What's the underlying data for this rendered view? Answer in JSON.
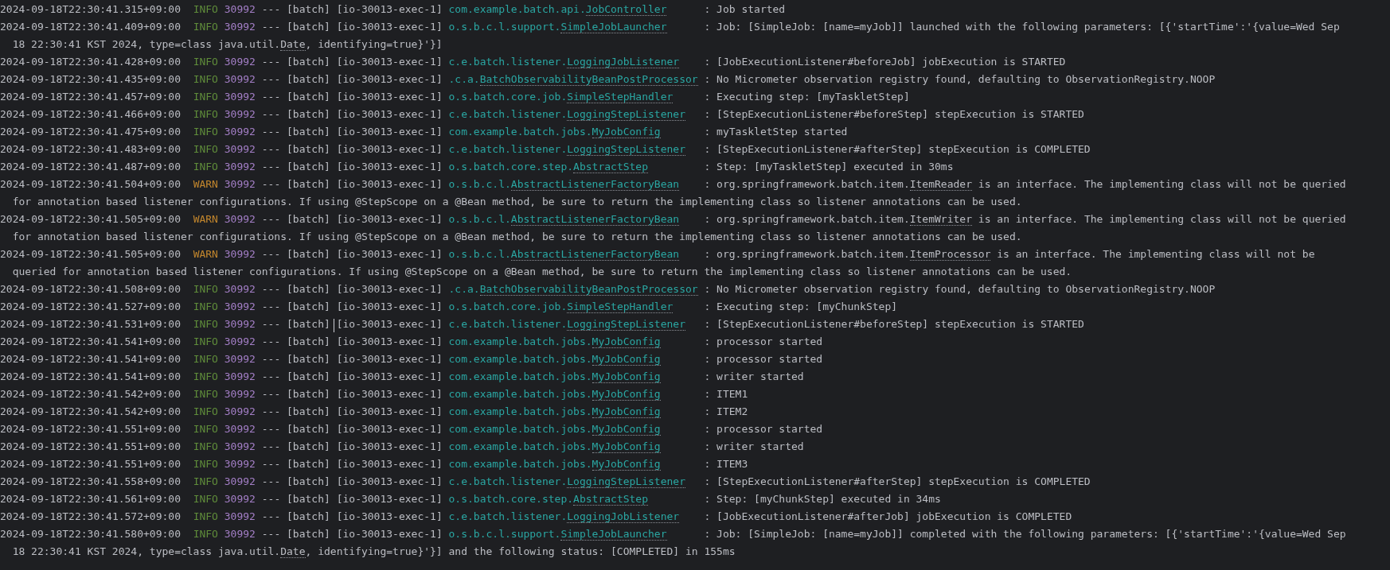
{
  "console": {
    "entries": [
      {
        "timestamp": "2024-09-18T22:30:41.315+09:00",
        "level": "INFO",
        "kind": "info",
        "pid": "30992",
        "separator": "---",
        "app": "[batch]",
        "thread": "[io-30013-exec-1]",
        "logger": {
          "package": "com.example.batch.api.",
          "class": "JobController"
        },
        "lines": [
          {
            "pre": ": Job started"
          }
        ]
      },
      {
        "timestamp": "2024-09-18T22:30:41.409+09:00",
        "level": "INFO",
        "kind": "info",
        "pid": "30992",
        "separator": "---",
        "app": "[batch]",
        "thread": "[io-30013-exec-1]",
        "logger": {
          "package": "o.s.b.c.l.support.",
          "class": "SimpleJobLauncher"
        },
        "lines": [
          {
            "pre": ": Job: [SimpleJob: [name=myJob]] launched with the following parameters: [{'startTime':'{value=Wed Sep"
          },
          {
            "pre": "18 22:30:41 KST 2024, type=class java.util.",
            "link": "Date",
            "post": ", identifying=true}'}]"
          }
        ]
      },
      {
        "timestamp": "2024-09-18T22:30:41.428+09:00",
        "level": "INFO",
        "kind": "info",
        "pid": "30992",
        "separator": "---",
        "app": "[batch]",
        "thread": "[io-30013-exec-1]",
        "logger": {
          "package": "c.e.batch.listener.",
          "class": "LoggingJobListener"
        },
        "lines": [
          {
            "pre": ": [JobExecutionListener#beforeJob] jobExecution is STARTED"
          }
        ]
      },
      {
        "timestamp": "2024-09-18T22:30:41.435+09:00",
        "level": "INFO",
        "kind": "info",
        "pid": "30992",
        "separator": "---",
        "app": "[batch]",
        "thread": "[io-30013-exec-1]",
        "logger": {
          "package": ".c.a.",
          "class": "BatchObservabilityBeanPostProcessor"
        },
        "lines": [
          {
            "pre": ": No Micrometer observation registry found, defaulting to ObservationRegistry.NOOP"
          }
        ]
      },
      {
        "timestamp": "2024-09-18T22:30:41.457+09:00",
        "level": "INFO",
        "kind": "info",
        "pid": "30992",
        "separator": "---",
        "app": "[batch]",
        "thread": "[io-30013-exec-1]",
        "logger": {
          "package": "o.s.batch.core.job.",
          "class": "SimpleStepHandler"
        },
        "lines": [
          {
            "pre": ": Executing step: [myTaskletStep]"
          }
        ]
      },
      {
        "timestamp": "2024-09-18T22:30:41.466+09:00",
        "level": "INFO",
        "kind": "info",
        "pid": "30992",
        "separator": "---",
        "app": "[batch]",
        "thread": "[io-30013-exec-1]",
        "logger": {
          "package": "c.e.batch.listener.",
          "class": "LoggingStepListener"
        },
        "lines": [
          {
            "pre": ": [StepExecutionListener#beforeStep] stepExecution is STARTED"
          }
        ]
      },
      {
        "timestamp": "2024-09-18T22:30:41.475+09:00",
        "level": "INFO",
        "kind": "info",
        "pid": "30992",
        "separator": "---",
        "app": "[batch]",
        "thread": "[io-30013-exec-1]",
        "logger": {
          "package": "com.example.batch.jobs.",
          "class": "MyJobConfig"
        },
        "lines": [
          {
            "pre": ": myTaskletStep started"
          }
        ]
      },
      {
        "timestamp": "2024-09-18T22:30:41.483+09:00",
        "level": "INFO",
        "kind": "info",
        "pid": "30992",
        "separator": "---",
        "app": "[batch]",
        "thread": "[io-30013-exec-1]",
        "logger": {
          "package": "c.e.batch.listener.",
          "class": "LoggingStepListener"
        },
        "lines": [
          {
            "pre": ": [StepExecutionListener#afterStep] stepExecution is COMPLETED"
          }
        ]
      },
      {
        "timestamp": "2024-09-18T22:30:41.487+09:00",
        "level": "INFO",
        "kind": "info",
        "pid": "30992",
        "separator": "---",
        "app": "[batch]",
        "thread": "[io-30013-exec-1]",
        "logger": {
          "package": "o.s.batch.core.step.",
          "class": "AbstractStep"
        },
        "lines": [
          {
            "pre": ": Step: [myTaskletStep] executed in 30ms"
          }
        ]
      },
      {
        "timestamp": "2024-09-18T22:30:41.504+09:00",
        "level": "WARN",
        "kind": "warn",
        "pid": "30992",
        "separator": "---",
        "app": "[batch]",
        "thread": "[io-30013-exec-1]",
        "logger": {
          "package": "o.s.b.c.l.",
          "class": "AbstractListenerFactoryBean"
        },
        "lines": [
          {
            "pre": ": org.springframework.batch.item.",
            "link": "ItemReader",
            "post": " is an interface. The implementing class will not be queried"
          },
          {
            "pre": "for annotation based listener configurations. If using @StepScope on a @Bean method, be sure to return the implementing class so listener annotations can be used."
          }
        ]
      },
      {
        "timestamp": "2024-09-18T22:30:41.505+09:00",
        "level": "WARN",
        "kind": "warn",
        "pid": "30992",
        "separator": "---",
        "app": "[batch]",
        "thread": "[io-30013-exec-1]",
        "logger": {
          "package": "o.s.b.c.l.",
          "class": "AbstractListenerFactoryBean"
        },
        "lines": [
          {
            "pre": ": org.springframework.batch.item.",
            "link": "ItemWriter",
            "post": " is an interface. The implementing class will not be queried"
          },
          {
            "pre": "for annotation based listener configurations. If using @StepScope on a @Bean method, be sure to return the implementing class so listener annotations can be used."
          }
        ]
      },
      {
        "timestamp": "2024-09-18T22:30:41.505+09:00",
        "level": "WARN",
        "kind": "warn",
        "pid": "30992",
        "separator": "---",
        "app": "[batch]",
        "thread": "[io-30013-exec-1]",
        "logger": {
          "package": "o.s.b.c.l.",
          "class": "AbstractListenerFactoryBean"
        },
        "lines": [
          {
            "pre": ": org.springframework.batch.item.",
            "link": "ItemProcessor",
            "post": " is an interface. The implementing class will not be"
          },
          {
            "pre": "queried for annotation based listener configurations. If using @StepScope on a @Bean method, be sure to return the implementing class so listener annotations can be used."
          }
        ]
      },
      {
        "timestamp": "2024-09-18T22:30:41.508+09:00",
        "level": "INFO",
        "kind": "info",
        "pid": "30992",
        "separator": "---",
        "app": "[batch]",
        "thread": "[io-30013-exec-1]",
        "logger": {
          "package": ".c.a.",
          "class": "BatchObservabilityBeanPostProcessor"
        },
        "lines": [
          {
            "pre": ": No Micrometer observation registry found, defaulting to ObservationRegistry.NOOP"
          }
        ]
      },
      {
        "timestamp": "2024-09-18T22:30:41.527+09:00",
        "level": "INFO",
        "kind": "info",
        "pid": "30992",
        "separator": "---",
        "app": "[batch]",
        "thread": "[io-30013-exec-1]",
        "logger": {
          "package": "o.s.batch.core.job.",
          "class": "SimpleStepHandler"
        },
        "lines": [
          {
            "pre": ": Executing step: [myChunkStep]"
          }
        ]
      },
      {
        "timestamp": "2024-09-18T22:30:41.531+09:00",
        "level": "INFO",
        "kind": "info",
        "pid": "30992",
        "separator": "---",
        "app": "[batch]",
        "cursor": true,
        "thread": "[io-30013-exec-1]",
        "logger": {
          "package": "c.e.batch.listener.",
          "class": "LoggingStepListener"
        },
        "lines": [
          {
            "pre": ": [StepExecutionListener#beforeStep] stepExecution is STARTED"
          }
        ]
      },
      {
        "timestamp": "2024-09-18T22:30:41.541+09:00",
        "level": "INFO",
        "kind": "info",
        "pid": "30992",
        "separator": "---",
        "app": "[batch]",
        "thread": "[io-30013-exec-1]",
        "logger": {
          "package": "com.example.batch.jobs.",
          "class": "MyJobConfig"
        },
        "lines": [
          {
            "pre": ": processor started"
          }
        ]
      },
      {
        "timestamp": "2024-09-18T22:30:41.541+09:00",
        "level": "INFO",
        "kind": "info",
        "pid": "30992",
        "separator": "---",
        "app": "[batch]",
        "thread": "[io-30013-exec-1]",
        "logger": {
          "package": "com.example.batch.jobs.",
          "class": "MyJobConfig"
        },
        "lines": [
          {
            "pre": ": processor started"
          }
        ]
      },
      {
        "timestamp": "2024-09-18T22:30:41.541+09:00",
        "level": "INFO",
        "kind": "info",
        "pid": "30992",
        "separator": "---",
        "app": "[batch]",
        "thread": "[io-30013-exec-1]",
        "logger": {
          "package": "com.example.batch.jobs.",
          "class": "MyJobConfig"
        },
        "lines": [
          {
            "pre": ": writer started"
          }
        ]
      },
      {
        "timestamp": "2024-09-18T22:30:41.542+09:00",
        "level": "INFO",
        "kind": "info",
        "pid": "30992",
        "separator": "---",
        "app": "[batch]",
        "thread": "[io-30013-exec-1]",
        "logger": {
          "package": "com.example.batch.jobs.",
          "class": "MyJobConfig"
        },
        "lines": [
          {
            "pre": ": ITEM1"
          }
        ]
      },
      {
        "timestamp": "2024-09-18T22:30:41.542+09:00",
        "level": "INFO",
        "kind": "info",
        "pid": "30992",
        "separator": "---",
        "app": "[batch]",
        "thread": "[io-30013-exec-1]",
        "logger": {
          "package": "com.example.batch.jobs.",
          "class": "MyJobConfig"
        },
        "lines": [
          {
            "pre": ": ITEM2"
          }
        ]
      },
      {
        "timestamp": "2024-09-18T22:30:41.551+09:00",
        "level": "INFO",
        "kind": "info",
        "pid": "30992",
        "separator": "---",
        "app": "[batch]",
        "thread": "[io-30013-exec-1]",
        "logger": {
          "package": "com.example.batch.jobs.",
          "class": "MyJobConfig"
        },
        "lines": [
          {
            "pre": ": processor started"
          }
        ]
      },
      {
        "timestamp": "2024-09-18T22:30:41.551+09:00",
        "level": "INFO",
        "kind": "info",
        "pid": "30992",
        "separator": "---",
        "app": "[batch]",
        "thread": "[io-30013-exec-1]",
        "logger": {
          "package": "com.example.batch.jobs.",
          "class": "MyJobConfig"
        },
        "lines": [
          {
            "pre": ": writer started"
          }
        ]
      },
      {
        "timestamp": "2024-09-18T22:30:41.551+09:00",
        "level": "INFO",
        "kind": "info",
        "pid": "30992",
        "separator": "---",
        "app": "[batch]",
        "thread": "[io-30013-exec-1]",
        "logger": {
          "package": "com.example.batch.jobs.",
          "class": "MyJobConfig"
        },
        "lines": [
          {
            "pre": ": ITEM3"
          }
        ]
      },
      {
        "timestamp": "2024-09-18T22:30:41.558+09:00",
        "level": "INFO",
        "kind": "info",
        "pid": "30992",
        "separator": "---",
        "app": "[batch]",
        "thread": "[io-30013-exec-1]",
        "logger": {
          "package": "c.e.batch.listener.",
          "class": "LoggingStepListener"
        },
        "lines": [
          {
            "pre": ": [StepExecutionListener#afterStep] stepExecution is COMPLETED"
          }
        ]
      },
      {
        "timestamp": "2024-09-18T22:30:41.561+09:00",
        "level": "INFO",
        "kind": "info",
        "pid": "30992",
        "separator": "---",
        "app": "[batch]",
        "thread": "[io-30013-exec-1]",
        "logger": {
          "package": "o.s.batch.core.step.",
          "class": "AbstractStep"
        },
        "lines": [
          {
            "pre": ": Step: [myChunkStep] executed in 34ms"
          }
        ]
      },
      {
        "timestamp": "2024-09-18T22:30:41.572+09:00",
        "level": "INFO",
        "kind": "info",
        "pid": "30992",
        "separator": "---",
        "app": "[batch]",
        "thread": "[io-30013-exec-1]",
        "logger": {
          "package": "c.e.batch.listener.",
          "class": "LoggingJobListener"
        },
        "lines": [
          {
            "pre": ": [JobExecutionListener#afterJob] jobExecution is COMPLETED"
          }
        ]
      },
      {
        "timestamp": "2024-09-18T22:30:41.580+09:00",
        "level": "INFO",
        "kind": "info",
        "pid": "30992",
        "separator": "---",
        "app": "[batch]",
        "thread": "[io-30013-exec-1]",
        "logger": {
          "package": "o.s.b.c.l.support.",
          "class": "SimpleJobLauncher"
        },
        "lines": [
          {
            "pre": ": Job: [SimpleJob: [name=myJob]] completed with the following parameters: [{'startTime':'{value=Wed Sep"
          },
          {
            "pre": "18 22:30:41 KST 2024, type=class java.util.",
            "link": "Date",
            "post": ", identifying=true}'}] and the following status: [COMPLETED] in 155ms"
          }
        ]
      }
    ]
  }
}
